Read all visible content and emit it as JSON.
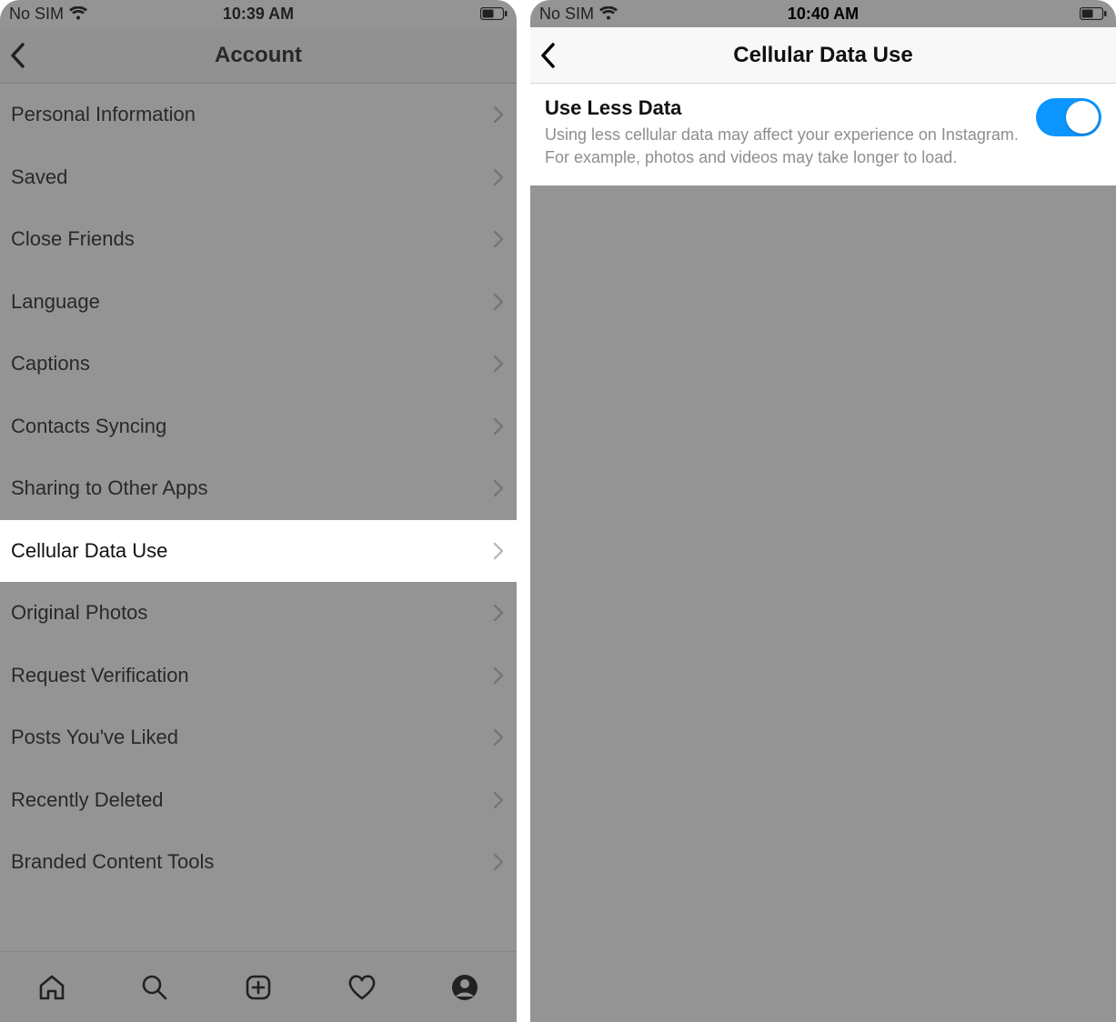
{
  "left": {
    "status": {
      "carrier": "No SIM",
      "time": "10:39 AM"
    },
    "nav": {
      "title": "Account"
    },
    "rows": [
      {
        "label": "Personal Information"
      },
      {
        "label": "Saved"
      },
      {
        "label": "Close Friends"
      },
      {
        "label": "Language"
      },
      {
        "label": "Captions"
      },
      {
        "label": "Contacts Syncing"
      },
      {
        "label": "Sharing to Other Apps"
      },
      {
        "label": "Cellular Data Use",
        "highlight": true
      },
      {
        "label": "Original Photos"
      },
      {
        "label": "Request Verification"
      },
      {
        "label": "Posts You've Liked"
      },
      {
        "label": "Recently Deleted"
      },
      {
        "label": "Branded Content Tools"
      }
    ],
    "tabs": [
      "home",
      "search",
      "create",
      "activity",
      "profile"
    ]
  },
  "right": {
    "status": {
      "carrier": "No SIM",
      "time": "10:40 AM"
    },
    "nav": {
      "title": "Cellular Data Use"
    },
    "setting": {
      "title": "Use Less Data",
      "desc": "Using less cellular data may affect your experience on Instagram. For example, photos and videos may take longer to load.",
      "on": true
    }
  },
  "colors": {
    "accent": "#0a95ff"
  }
}
